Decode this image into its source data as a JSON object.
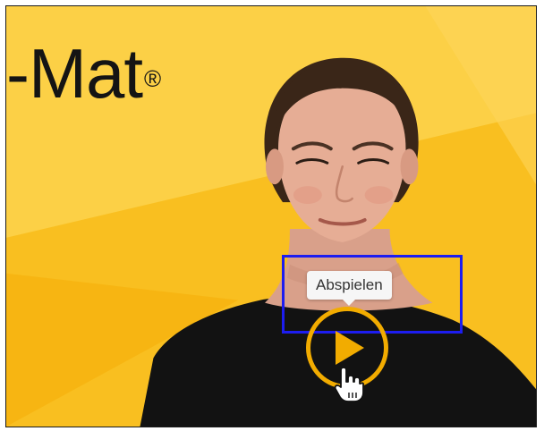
{
  "video": {
    "brand_text": "-Mat",
    "brand_mark": "®",
    "tooltip": "Abspielen",
    "play_button": {
      "icon": "play-icon"
    },
    "cursor": {
      "icon": "hand-pointer-icon"
    },
    "colors": {
      "background_light": "#fccf3e",
      "background_dark": "#f7b512",
      "accent": "#f2ac00",
      "highlight": "#1d1df0"
    }
  }
}
